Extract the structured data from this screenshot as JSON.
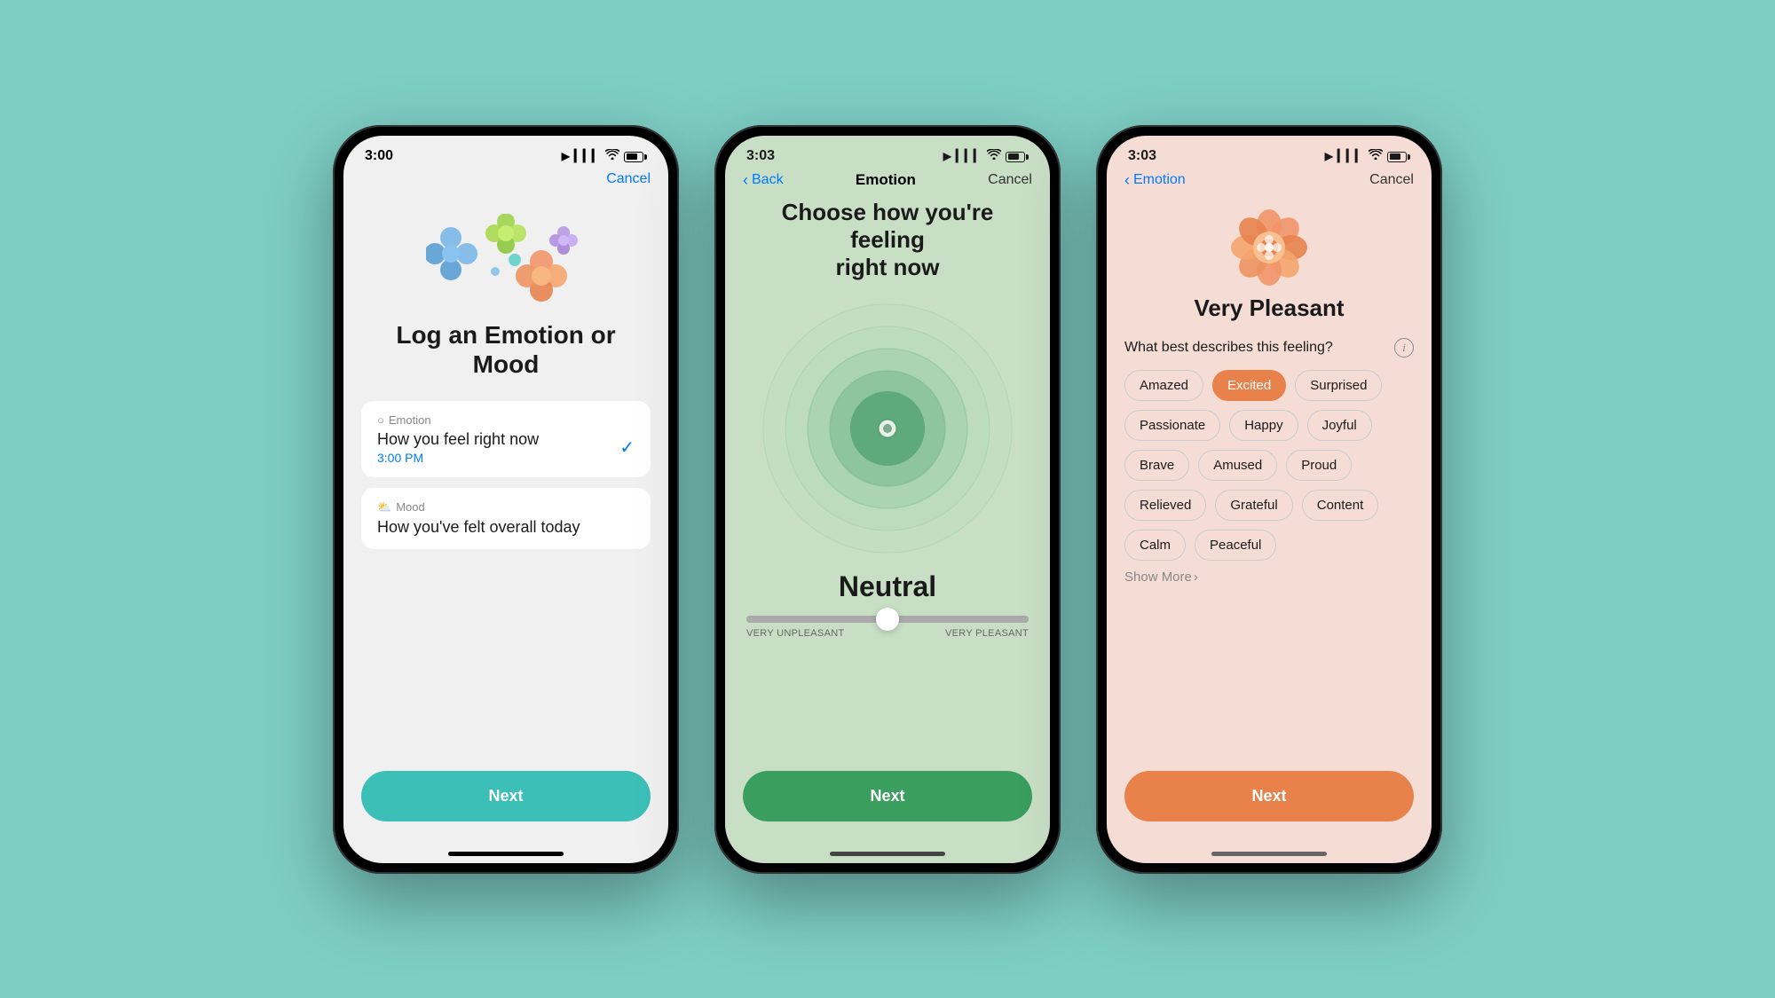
{
  "background": "#7ecec4",
  "phone1": {
    "status": {
      "time": "3:00",
      "location_icon": "▶",
      "signal_icon": "▎▎▎",
      "wifi_icon": "wifi",
      "battery": "74"
    },
    "nav": {
      "cancel": "Cancel"
    },
    "title": "Log an Emotion\nor Mood",
    "emotion_option": {
      "icon": "○",
      "label": "Emotion",
      "description": "How you feel right now",
      "time": "3:00 PM"
    },
    "mood_option": {
      "icon": "☁",
      "label": "Mood",
      "description": "How you've felt overall today"
    },
    "next_label": "Next",
    "next_color": "#3bbfb7"
  },
  "phone2": {
    "status": {
      "time": "3:03",
      "location_icon": "▶"
    },
    "nav": {
      "back": "Back",
      "title": "Emotion",
      "cancel": "Cancel"
    },
    "heading": "Choose how you're feeling\nright now",
    "mood_label": "Neutral",
    "slider_left": "VERY UNPLEASANT",
    "slider_right": "VERY PLEASANT",
    "next_label": "Next",
    "next_color": "#3a9e5f"
  },
  "phone3": {
    "status": {
      "time": "3:03",
      "location_icon": "▶"
    },
    "nav": {
      "back": "Emotion",
      "cancel": "Cancel"
    },
    "mood_level": "Very Pleasant",
    "question": "What best describes this feeling?",
    "chips": [
      {
        "label": "Amazed",
        "selected": false
      },
      {
        "label": "Excited",
        "selected": true
      },
      {
        "label": "Surprised",
        "selected": false
      },
      {
        "label": "Passionate",
        "selected": false
      },
      {
        "label": "Happy",
        "selected": false
      },
      {
        "label": "Joyful",
        "selected": false
      },
      {
        "label": "Brave",
        "selected": false
      },
      {
        "label": "Amused",
        "selected": false
      },
      {
        "label": "Proud",
        "selected": false
      },
      {
        "label": "Relieved",
        "selected": false
      },
      {
        "label": "Grateful",
        "selected": false
      },
      {
        "label": "Content",
        "selected": false
      },
      {
        "label": "Calm",
        "selected": false
      },
      {
        "label": "Peaceful",
        "selected": false
      }
    ],
    "show_more": "Show More",
    "next_label": "Next",
    "next_color": "#e8824a"
  }
}
